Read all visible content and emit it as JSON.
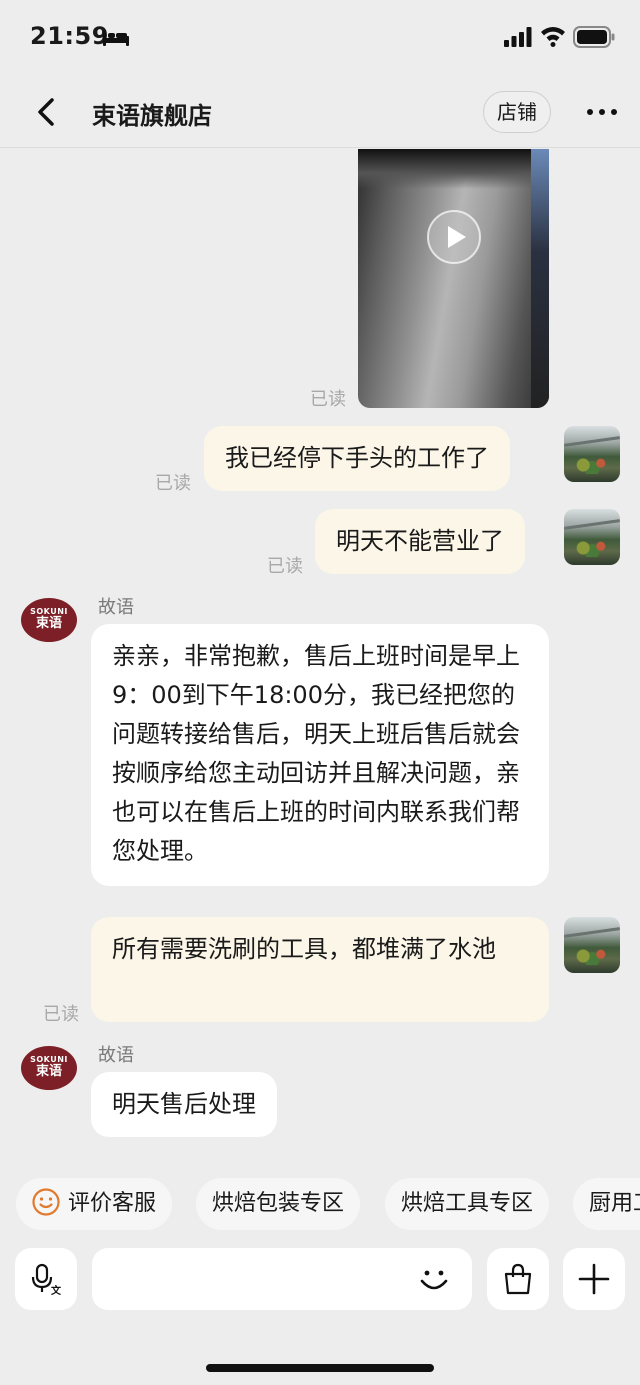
{
  "status_bar": {
    "time": "21:59"
  },
  "header": {
    "title": "束语旗舰店",
    "store_label": "店铺"
  },
  "shop_avatar": {
    "brand": "SOKUNI",
    "brand_cn": "束语"
  },
  "messages": [
    {
      "type": "video",
      "from": "me",
      "read": "已读"
    },
    {
      "type": "text",
      "from": "me",
      "read": "已读",
      "text": "我已经停下手头的工作了"
    },
    {
      "type": "text",
      "from": "me",
      "read": "已读",
      "text": "明天不能营业了"
    },
    {
      "type": "text",
      "from": "shop",
      "sender": "故语",
      "text": "亲亲，非常抱歉，售后上班时间是早上9：00到下午18:00分，我已经把您的问题转接给售后，明天上班后售后就会按顺序给您主动回访并且解决问题，亲也可以在售后上班的时间内联系我们帮您处理。"
    },
    {
      "type": "text",
      "from": "me",
      "read": "已读",
      "text": "所有需要洗刷的工具，都堆满了水池"
    },
    {
      "type": "text",
      "from": "shop",
      "sender": "故语",
      "text": "明天售后处理"
    }
  ],
  "quick_replies": [
    "评价客服",
    "烘焙包装专区",
    "烘焙工具专区",
    "厨用工具"
  ],
  "input": {
    "value": "",
    "placeholder": ""
  },
  "icons": {
    "back": "chevron-left-icon",
    "more": "more-dots-icon",
    "voice": "voice-translate-icon",
    "emoji": "smile-icon",
    "shop": "shopping-bag-icon",
    "add": "plus-icon"
  }
}
